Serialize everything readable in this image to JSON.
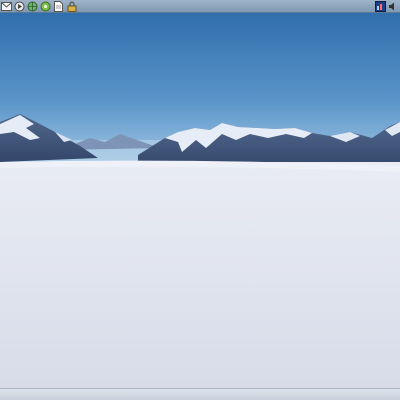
{
  "desktop": {
    "wallpaper": {
      "subject": "snow-plain-mountain-range",
      "colors": {
        "sky_top": "#2f6fae",
        "sky_horizon": "#9dc4e4",
        "mountain_shadow": "#3f5578",
        "mountain_snow": "#e8eef7",
        "snowfield": "#dfe3ee"
      }
    }
  },
  "top_panel": {
    "launchers": [
      {
        "icon": "mail-icon"
      },
      {
        "icon": "browser-icon"
      },
      {
        "icon": "globe-icon"
      },
      {
        "icon": "chat-icon"
      },
      {
        "icon": "document-icon"
      },
      {
        "icon": "lock-icon"
      }
    ],
    "tray": [
      {
        "icon": "network-monitor-icon"
      },
      {
        "icon": "volume-icon"
      }
    ]
  }
}
